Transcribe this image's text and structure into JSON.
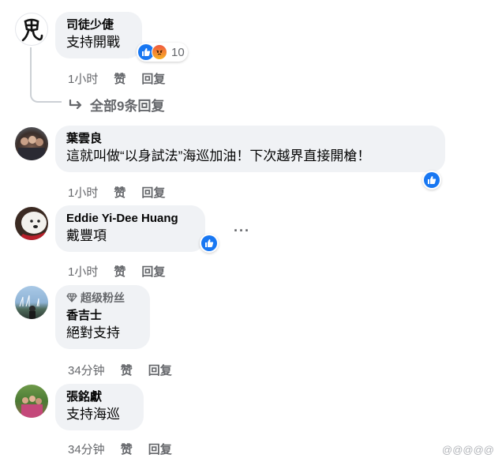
{
  "colors": {
    "like": "#1877f2",
    "bubble": "#f0f2f5",
    "secondary_text": "#65676b"
  },
  "comments": [
    {
      "author": "司徒少倢",
      "text": "支持開戰",
      "time": "1小时",
      "like_label": "赞",
      "reply_label": "回复",
      "reactions": {
        "types": [
          "like-icon",
          "angry-icon"
        ],
        "count": "10"
      },
      "replies_label": "全部9条回复"
    },
    {
      "author": "葉雲良",
      "text": "這就叫做“以身試法”海巡加油！下次越界直接開槍！",
      "time": "1小时",
      "like_label": "赞",
      "reply_label": "回复"
    },
    {
      "author": "Eddie Yi-Dee Huang",
      "text": "戴豐項",
      "time": "1小时",
      "like_label": "赞",
      "reply_label": "回复",
      "more_label": "···"
    },
    {
      "badge": "超级粉丝",
      "author": "香吉士",
      "text": "絕對支持",
      "time": "34分钟",
      "like_label": "赞",
      "reply_label": "回复"
    },
    {
      "author": "張銘獻",
      "text": "支持海巡",
      "time": "34分钟",
      "like_label": "赞",
      "reply_label": "回复"
    }
  ],
  "watermark": "@@@@@"
}
